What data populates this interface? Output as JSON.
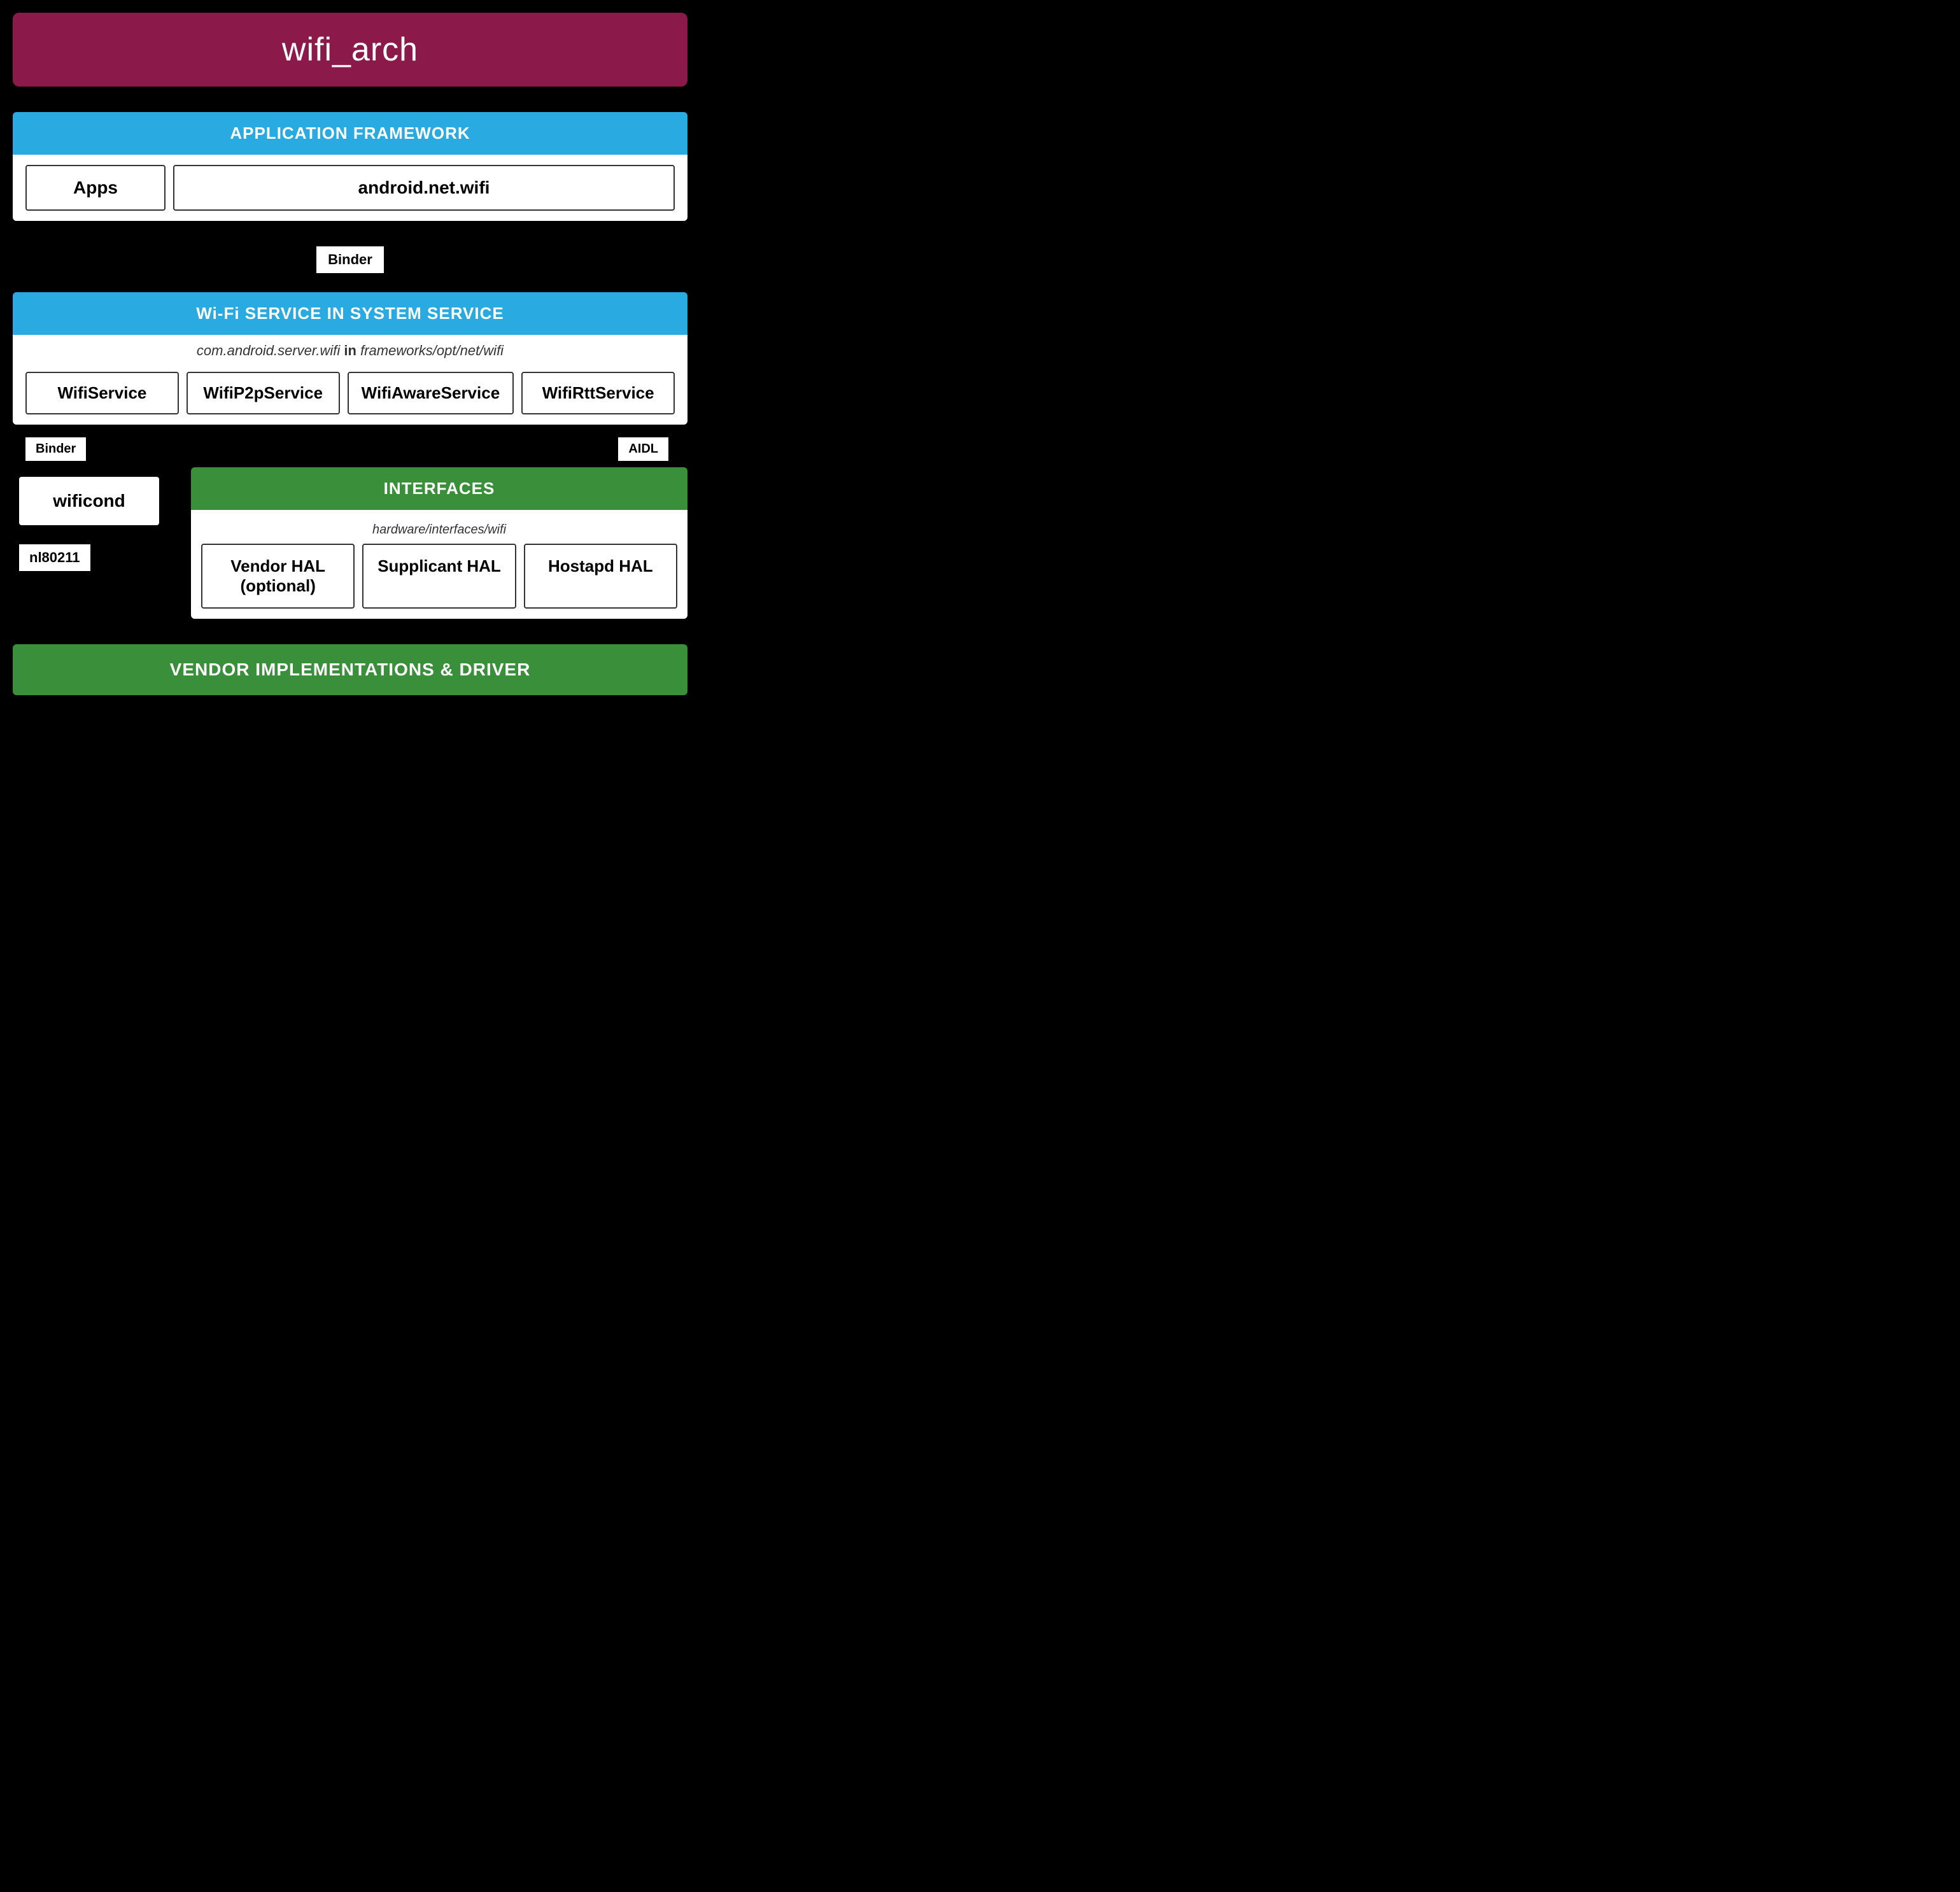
{
  "title": "wifi_arch",
  "app_framework": {
    "header": "APPLICATION FRAMEWORK",
    "apps_label": "Apps",
    "android_net_wifi_label": "android.net.wifi"
  },
  "binder_label": "Binder",
  "wifi_service": {
    "header": "Wi-Fi SERVICE IN SYSTEM SERVICE",
    "subtitle_pre": "com.android.server.wifi",
    "subtitle_bold": "in",
    "subtitle_post": "frameworks/opt/net/wifi",
    "services": [
      "WifiService",
      "WifiP2pService",
      "WifiAwareService",
      "WifiRttService"
    ]
  },
  "binder_label2": "Binder",
  "aidl_label": "AIDL",
  "wificond_label": "wificond",
  "nl80211_label": "nl80211",
  "interfaces": {
    "header": "INTERFACES",
    "hardware_path": "hardware/interfaces/wifi",
    "hal_items": [
      "Vendor HAL (optional)",
      "Supplicant HAL",
      "Hostapd HAL"
    ]
  },
  "vendor_implementations": "VENDOR IMPLEMENTATIONS & DRIVER"
}
